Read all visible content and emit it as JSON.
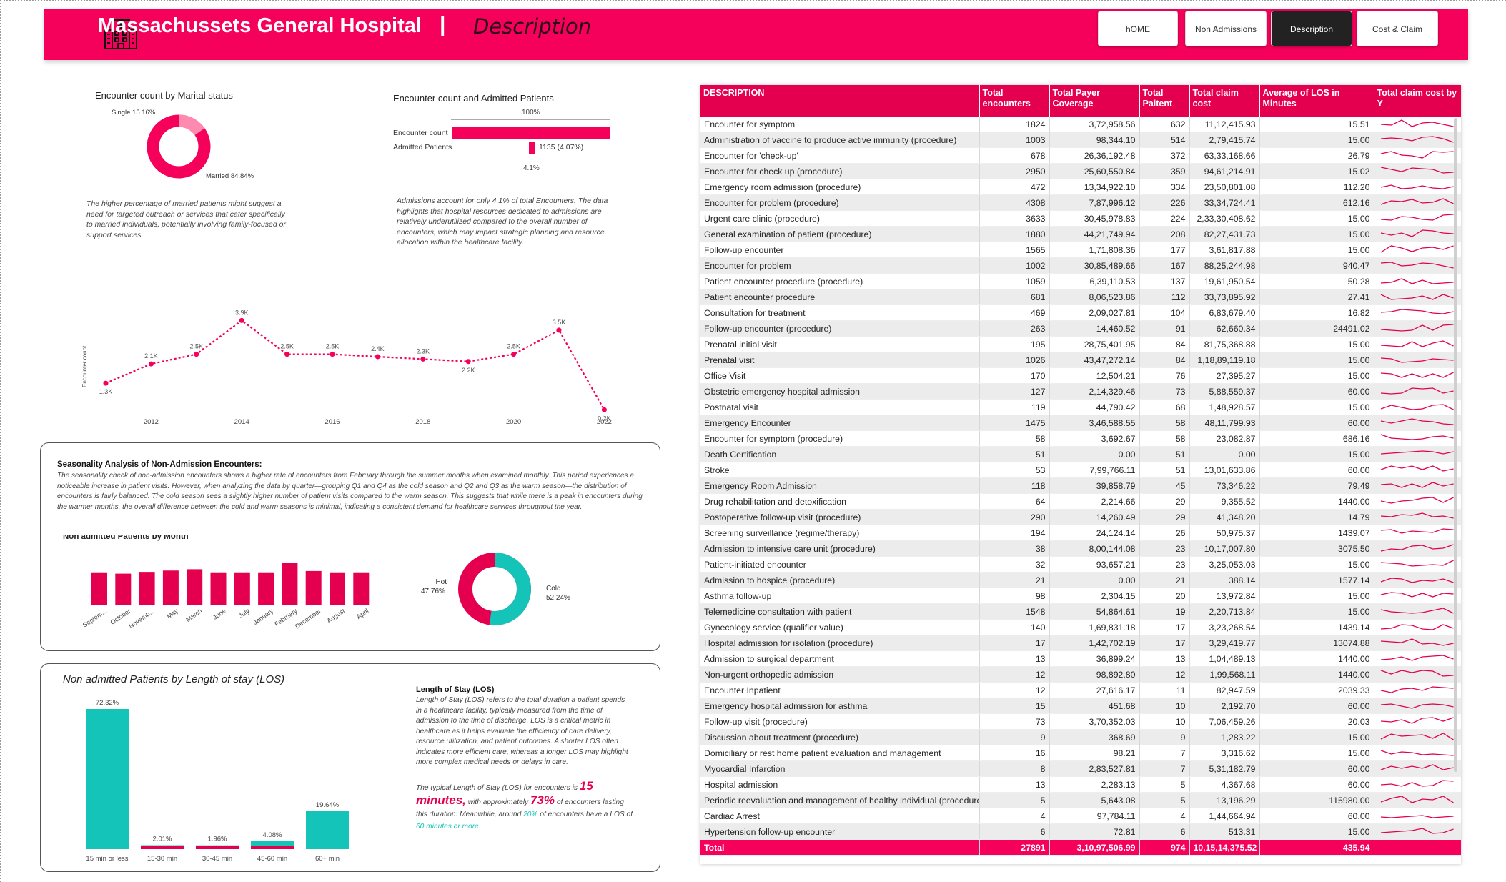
{
  "header": {
    "title": "Massachussets General Hospital",
    "separator": "|",
    "subtitle": "Description",
    "color": "#f5005a",
    "nav": [
      "hOME",
      "Non Admissions",
      "Description",
      "Cost & Claim"
    ],
    "active_nav": "Description"
  },
  "marital": {
    "title": "Encounter count by Marital status",
    "single_label": "Single 15.16%",
    "married_label": "Married 84.84%",
    "single_pct": 15.16,
    "married_pct": 84.84,
    "note": "The higher percentage of married patients might suggest a need for targeted outreach or services that cater specifically to married individuals, potentially involving family-focused or support services."
  },
  "admitted": {
    "title": "Encounter count and Admitted Patients",
    "top_label": "100%",
    "bar1_label": "Encounter count",
    "bar2_label": "Admitted Patients",
    "bar2_value": "1135 (4.07%)",
    "bottom_label": "4.1%",
    "encounter_pct": 100,
    "admitted_pct": 4.07,
    "note": "Admissions account for only 4.1% of total Encounters. The data highlights that hospital resources dedicated to admissions are relatively underutilized compared to the overall number of encounters, which may impact strategic planning and resource allocation within the healthcare facility."
  },
  "yearly": {
    "ylabel": "Encounter count",
    "ticks": [
      "2012",
      "2014",
      "2016",
      "2018",
      "2020",
      "2022"
    ],
    "chart_data": {
      "type": "line",
      "x": [
        2011,
        2012,
        2013,
        2014,
        2015,
        2016,
        2017,
        2018,
        2019,
        2020,
        2021,
        2022
      ],
      "y": [
        1.3,
        2.1,
        2.5,
        3.9,
        2.5,
        2.5,
        2.4,
        2.3,
        2.2,
        2.5,
        3.5,
        0.2
      ],
      "labels": [
        "1.3K",
        "2.1K",
        "2.5K",
        "3.9K",
        "2.5K",
        "2.5K",
        "2.4K",
        "2.3K",
        "2.2K",
        "2.5K",
        "3.5K",
        "0.2K"
      ]
    }
  },
  "season": {
    "title": "Seasonality Analysis of Non-Admission Encounters:",
    "text": "The seasonality check of non-admission encounters shows a higher rate of encounters from February through the summer months when examined monthly. This period experiences a noticeable increase in patient visits. However, when analyzing the data by quarter—grouping Q1 and Q4 as the cold season and Q2 and Q3 as the warm season—the distribution of encounters is fairly balanced. The cold season sees a slightly higher number of patient visits compared to the warm season. This suggests that while there is a peak in encounters during the warmer months, the overall difference between the cold and warm seasons is minimal, indicating a consistent demand for healthcare services throughout the year.",
    "month_title": "Non admitted Patients by Month",
    "month_chart": {
      "type": "bar",
      "categories": [
        "Septem...",
        "October",
        "Novemb...",
        "May",
        "March",
        "June",
        "July",
        "January",
        "February",
        "December",
        "August",
        "April"
      ],
      "values": [
        0.73,
        0.7,
        0.74,
        0.77,
        0.8,
        0.73,
        0.73,
        0.73,
        0.94,
        0.76,
        0.73,
        0.73
      ]
    },
    "hot_label": "Hot",
    "hot_pct": "47.76%",
    "cold_label": "Cold",
    "cold_pct": "52.24%",
    "hot_value": 47.76,
    "cold_value": 52.24,
    "hot_color": "#e5004f",
    "cold_color": "#14c4b8"
  },
  "los": {
    "title": "Non admitted Patients by Length of stay (LOS)",
    "chart_data": {
      "type": "bar",
      "categories": [
        "15 min or less",
        "15-30 min",
        "30-45 min",
        "45-60 min",
        "60+ min"
      ],
      "values": [
        72.32,
        2.01,
        1.96,
        4.08,
        19.64
      ],
      "labels": [
        "72.32%",
        "2.01%",
        "1.96%",
        "4.08%",
        "19.64%"
      ]
    },
    "def_title": "Length of Stay (LOS)",
    "def_text": "Length of Stay (LOS) refers to the total duration a patient spends in a healthcare facility, typically measured from the time of admission to the time of discharge. LOS is a critical metric in healthcare as it helps evaluate the efficiency of care delivery, resource utilization, and patient outcomes. A shorter LOS often indicates more efficient care, whereas a longer LOS may highlight more complex medical needs or delays in care.",
    "p1": "The typical Length of Stay (LOS) for encounters is",
    "big1": "15 minutes,",
    "p2": "with approximately",
    "big2": "73%",
    "p3": "of encounters lasting this duration. Meanwhile, around",
    "small1": "20%",
    "p4": "of encounters have a LOS of",
    "small2": "60 minutes or more."
  },
  "table": {
    "headers": [
      "DESCRIPTION",
      "Total encounters",
      "Total Payer Coverage",
      "Total Paitent",
      "Total claim cost",
      "Average of LOS in Minutes",
      "Total claim cost by Y"
    ],
    "rows": [
      [
        "Encounter for symptom",
        "1824",
        "3,72,958.56",
        "632",
        "11,12,415.93",
        "15.51"
      ],
      [
        "Administration of vaccine to produce active immunity (procedure)",
        "1003",
        "98,344.10",
        "514",
        "2,79,415.74",
        "15.00"
      ],
      [
        "Encounter for 'check-up'",
        "678",
        "26,36,192.48",
        "372",
        "63,33,168.66",
        "26.79"
      ],
      [
        "Encounter for check up (procedure)",
        "2950",
        "25,60,550.84",
        "359",
        "94,61,214.91",
        "15.02"
      ],
      [
        "Emergency room admission (procedure)",
        "472",
        "13,34,922.10",
        "334",
        "23,50,801.08",
        "112.20"
      ],
      [
        "Encounter for problem (procedure)",
        "4308",
        "7,87,996.12",
        "226",
        "33,34,724.41",
        "612.16"
      ],
      [
        "Urgent care clinic (procedure)",
        "3633",
        "30,45,978.83",
        "224",
        "2,33,30,408.62",
        "15.00"
      ],
      [
        "General examination of patient (procedure)",
        "1880",
        "44,21,749.94",
        "208",
        "82,27,431.73",
        "15.00"
      ],
      [
        "Follow-up encounter",
        "1565",
        "1,71,808.36",
        "177",
        "3,61,817.88",
        "15.00"
      ],
      [
        "Encounter for problem",
        "1002",
        "30,85,489.66",
        "167",
        "88,25,244.98",
        "940.47"
      ],
      [
        "Patient encounter procedure (procedure)",
        "1059",
        "6,39,110.53",
        "137",
        "19,61,950.54",
        "50.28"
      ],
      [
        "Patient encounter procedure",
        "681",
        "8,06,523.86",
        "112",
        "33,73,895.92",
        "27.41"
      ],
      [
        "Consultation for treatment",
        "469",
        "2,09,027.81",
        "104",
        "6,83,679.40",
        "16.82"
      ],
      [
        "Follow-up encounter (procedure)",
        "263",
        "14,460.52",
        "91",
        "62,660.34",
        "24491.02"
      ],
      [
        "Prenatal initial visit",
        "195",
        "28,75,401.95",
        "84",
        "81,75,368.88",
        "15.00"
      ],
      [
        "Prenatal visit",
        "1026",
        "43,47,272.14",
        "84",
        "1,18,89,119.18",
        "15.00"
      ],
      [
        "Office Visit",
        "170",
        "12,504.21",
        "76",
        "27,395.27",
        "15.00"
      ],
      [
        "Obstetric emergency hospital admission",
        "127",
        "2,14,329.46",
        "73",
        "5,88,559.37",
        "60.00"
      ],
      [
        "Postnatal visit",
        "119",
        "44,790.42",
        "68",
        "1,48,928.57",
        "15.00"
      ],
      [
        "Emergency Encounter",
        "1475",
        "3,46,588.55",
        "58",
        "48,11,799.93",
        "60.00"
      ],
      [
        "Encounter for symptom (procedure)",
        "58",
        "3,692.67",
        "58",
        "23,082.87",
        "686.16"
      ],
      [
        "Death Certification",
        "51",
        "0.00",
        "51",
        "0.00",
        "15.00"
      ],
      [
        "Stroke",
        "53",
        "7,99,766.11",
        "51",
        "13,01,633.86",
        "60.00"
      ],
      [
        "Emergency Room Admission",
        "118",
        "39,858.79",
        "45",
        "73,346.22",
        "79.49"
      ],
      [
        "Drug rehabilitation and detoxification",
        "64",
        "2,214.66",
        "29",
        "9,355.52",
        "1440.00"
      ],
      [
        "Postoperative follow-up visit (procedure)",
        "290",
        "14,260.49",
        "29",
        "41,348.20",
        "14.79"
      ],
      [
        "Screening surveillance (regime/therapy)",
        "194",
        "24,124.14",
        "26",
        "50,975.37",
        "1439.07"
      ],
      [
        "Admission to intensive care unit (procedure)",
        "38",
        "8,00,144.08",
        "23",
        "10,17,007.80",
        "3075.50"
      ],
      [
        "Patient-initiated encounter",
        "32",
        "93,657.21",
        "23",
        "3,25,053.03",
        "15.00"
      ],
      [
        "Admission to hospice (procedure)",
        "21",
        "0.00",
        "21",
        "388.14",
        "1577.14"
      ],
      [
        "Asthma follow-up",
        "98",
        "2,304.15",
        "20",
        "13,972.84",
        "15.00"
      ],
      [
        "Telemedicine consultation with patient",
        "1548",
        "54,864.61",
        "19",
        "2,20,713.84",
        "15.00"
      ],
      [
        "Gynecology service (qualifier value)",
        "140",
        "1,69,831.18",
        "17",
        "3,23,268.54",
        "1439.14"
      ],
      [
        "Hospital admission for isolation (procedure)",
        "17",
        "1,42,702.19",
        "17",
        "3,29,419.77",
        "13074.88"
      ],
      [
        "Admission to surgical department",
        "13",
        "36,899.24",
        "13",
        "1,04,489.13",
        "1440.00"
      ],
      [
        "Non-urgent orthopedic admission",
        "12",
        "98,892.80",
        "12",
        "1,99,568.11",
        "1440.00"
      ],
      [
        "Encounter Inpatient",
        "12",
        "27,616.17",
        "11",
        "82,947.59",
        "2039.33"
      ],
      [
        "Emergency hospital admission for asthma",
        "15",
        "451.68",
        "10",
        "2,192.70",
        "60.00"
      ],
      [
        "Follow-up visit (procedure)",
        "73",
        "3,70,352.03",
        "10",
        "7,06,459.26",
        "20.03"
      ],
      [
        "Discussion about treatment (procedure)",
        "9",
        "368.69",
        "9",
        "1,283.22",
        "15.00"
      ],
      [
        "Domiciliary or rest home patient evaluation and management",
        "16",
        "98.21",
        "7",
        "3,316.62",
        "15.00"
      ],
      [
        "Myocardial Infarction",
        "8",
        "2,83,527.81",
        "7",
        "5,31,182.79",
        "60.00"
      ],
      [
        "Hospital admission",
        "13",
        "2,283.13",
        "5",
        "4,367.68",
        "60.00"
      ],
      [
        "Periodic reevaluation and management of healthy individual (procedure)",
        "5",
        "5,643.08",
        "5",
        "13,196.29",
        "115980.00"
      ],
      [
        "Cardiac Arrest",
        "4",
        "97,784.11",
        "4",
        "1,44,664.94",
        "60.00"
      ],
      [
        "Hypertension follow-up encounter",
        "6",
        "72.81",
        "6",
        "513.31",
        "15.00"
      ]
    ],
    "total": [
      "Total",
      "27891",
      "3,10,97,506.99",
      "974",
      "10,15,14,375.52",
      "435.94"
    ]
  }
}
